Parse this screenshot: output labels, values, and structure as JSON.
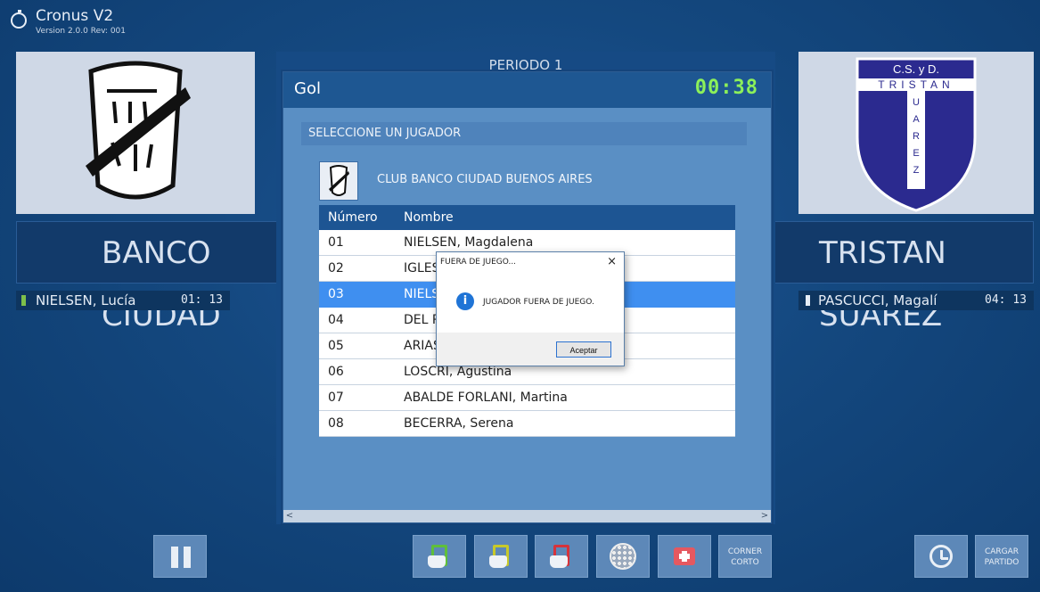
{
  "app": {
    "title": "Cronus V2",
    "version": "Version 2.0.0 Rev: 001"
  },
  "match": {
    "period": "PERIODO 1",
    "home": {
      "name": "BANCO CIUDAD",
      "player": {
        "name": "NIELSEN, Lucía",
        "time": "01: 13"
      }
    },
    "away": {
      "name": "TRISTAN SUAREZ",
      "player": {
        "name": "PASCUCCI, Magalí",
        "time": "04: 13"
      }
    }
  },
  "dialog": {
    "title": "Gol",
    "timer": "00:38",
    "prompt": "SELECCIONE UN JUGADOR",
    "club": "CLUB BANCO CIUDAD BUENOS AIRES",
    "columns": [
      "Número",
      "Nombre"
    ],
    "selected_row": 2,
    "rows": [
      {
        "number": "01",
        "name": "NIELSEN, Magdalena"
      },
      {
        "number": "02",
        "name": "IGLESI"
      },
      {
        "number": "03",
        "name": "NIELS"
      },
      {
        "number": "04",
        "name": "DEL P/"
      },
      {
        "number": "05",
        "name": "ARIAS"
      },
      {
        "number": "06",
        "name": "LOSCRI, Agustina"
      },
      {
        "number": "07",
        "name": "ABALDE FORLANI, Martina"
      },
      {
        "number": "08",
        "name": "BECERRA, Serena"
      }
    ]
  },
  "message_box": {
    "title": "FUERA DE JUEGO...",
    "close": "×",
    "icon_label": "i",
    "text": "JUGADOR FUERA DE JUEGO.",
    "ok": "Aceptar"
  },
  "scrollbar": {
    "left": "<",
    "right": ">"
  },
  "toolbar": {
    "corner_line1": "CORNER",
    "corner_line2": "CORTO",
    "cargar_line1": "CARGAR",
    "cargar_line2": "PARTIDO"
  },
  "icons": {
    "app": "stopwatch-icon",
    "pause": "pause-icon",
    "green_card": "green-card-icon",
    "yellow_card": "yellow-card-icon",
    "red_card": "red-card-icon",
    "ball": "ball-icon",
    "medical": "first-aid-kit-icon",
    "history": "history-icon",
    "info": "info-icon"
  },
  "colors": {
    "green_card": "#5fbf3a",
    "yellow_card": "#c7c92a",
    "red_card": "#d6333b",
    "timer": "#8cf05a",
    "selected_row": "#3f8ff0"
  }
}
